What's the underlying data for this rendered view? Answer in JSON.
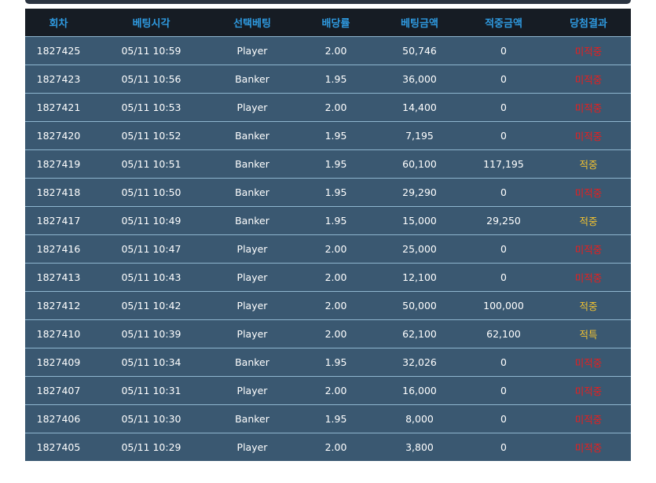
{
  "colors": {
    "header_bg": "#161c24",
    "header_text": "#2f9ae0",
    "row_bg": "#3a5871",
    "row_border": "#8fb6cf",
    "lose": "#e81e1e",
    "win": "#f2c230"
  },
  "table": {
    "headers": [
      "회차",
      "베팅시각",
      "선택베팅",
      "배당률",
      "베팅금액",
      "적중금액",
      "당첨결과"
    ],
    "rows": [
      {
        "round": "1827425",
        "time": "05/11 10:59",
        "pick": "Player",
        "odds": "2.00",
        "bet": "50,746",
        "win": "0",
        "result": "미적중",
        "status": "lose"
      },
      {
        "round": "1827423",
        "time": "05/11 10:56",
        "pick": "Banker",
        "odds": "1.95",
        "bet": "36,000",
        "win": "0",
        "result": "미적중",
        "status": "lose"
      },
      {
        "round": "1827421",
        "time": "05/11 10:53",
        "pick": "Player",
        "odds": "2.00",
        "bet": "14,400",
        "win": "0",
        "result": "미적중",
        "status": "lose"
      },
      {
        "round": "1827420",
        "time": "05/11 10:52",
        "pick": "Banker",
        "odds": "1.95",
        "bet": "7,195",
        "win": "0",
        "result": "미적중",
        "status": "lose"
      },
      {
        "round": "1827419",
        "time": "05/11 10:51",
        "pick": "Banker",
        "odds": "1.95",
        "bet": "60,100",
        "win": "117,195",
        "result": "적중",
        "status": "win"
      },
      {
        "round": "1827418",
        "time": "05/11 10:50",
        "pick": "Banker",
        "odds": "1.95",
        "bet": "29,290",
        "win": "0",
        "result": "미적중",
        "status": "lose"
      },
      {
        "round": "1827417",
        "time": "05/11 10:49",
        "pick": "Banker",
        "odds": "1.95",
        "bet": "15,000",
        "win": "29,250",
        "result": "적중",
        "status": "win"
      },
      {
        "round": "1827416",
        "time": "05/11 10:47",
        "pick": "Player",
        "odds": "2.00",
        "bet": "25,000",
        "win": "0",
        "result": "미적중",
        "status": "lose"
      },
      {
        "round": "1827413",
        "time": "05/11 10:43",
        "pick": "Player",
        "odds": "2.00",
        "bet": "12,100",
        "win": "0",
        "result": "미적중",
        "status": "lose"
      },
      {
        "round": "1827412",
        "time": "05/11 10:42",
        "pick": "Player",
        "odds": "2.00",
        "bet": "50,000",
        "win": "100,000",
        "result": "적중",
        "status": "win"
      },
      {
        "round": "1827410",
        "time": "05/11 10:39",
        "pick": "Player",
        "odds": "2.00",
        "bet": "62,100",
        "win": "62,100",
        "result": "적특",
        "status": "win"
      },
      {
        "round": "1827409",
        "time": "05/11 10:34",
        "pick": "Banker",
        "odds": "1.95",
        "bet": "32,026",
        "win": "0",
        "result": "미적중",
        "status": "lose"
      },
      {
        "round": "1827407",
        "time": "05/11 10:31",
        "pick": "Player",
        "odds": "2.00",
        "bet": "16,000",
        "win": "0",
        "result": "미적중",
        "status": "lose"
      },
      {
        "round": "1827406",
        "time": "05/11 10:30",
        "pick": "Banker",
        "odds": "1.95",
        "bet": "8,000",
        "win": "0",
        "result": "미적중",
        "status": "lose"
      },
      {
        "round": "1827405",
        "time": "05/11 10:29",
        "pick": "Player",
        "odds": "2.00",
        "bet": "3,800",
        "win": "0",
        "result": "미적중",
        "status": "lose"
      }
    ]
  }
}
